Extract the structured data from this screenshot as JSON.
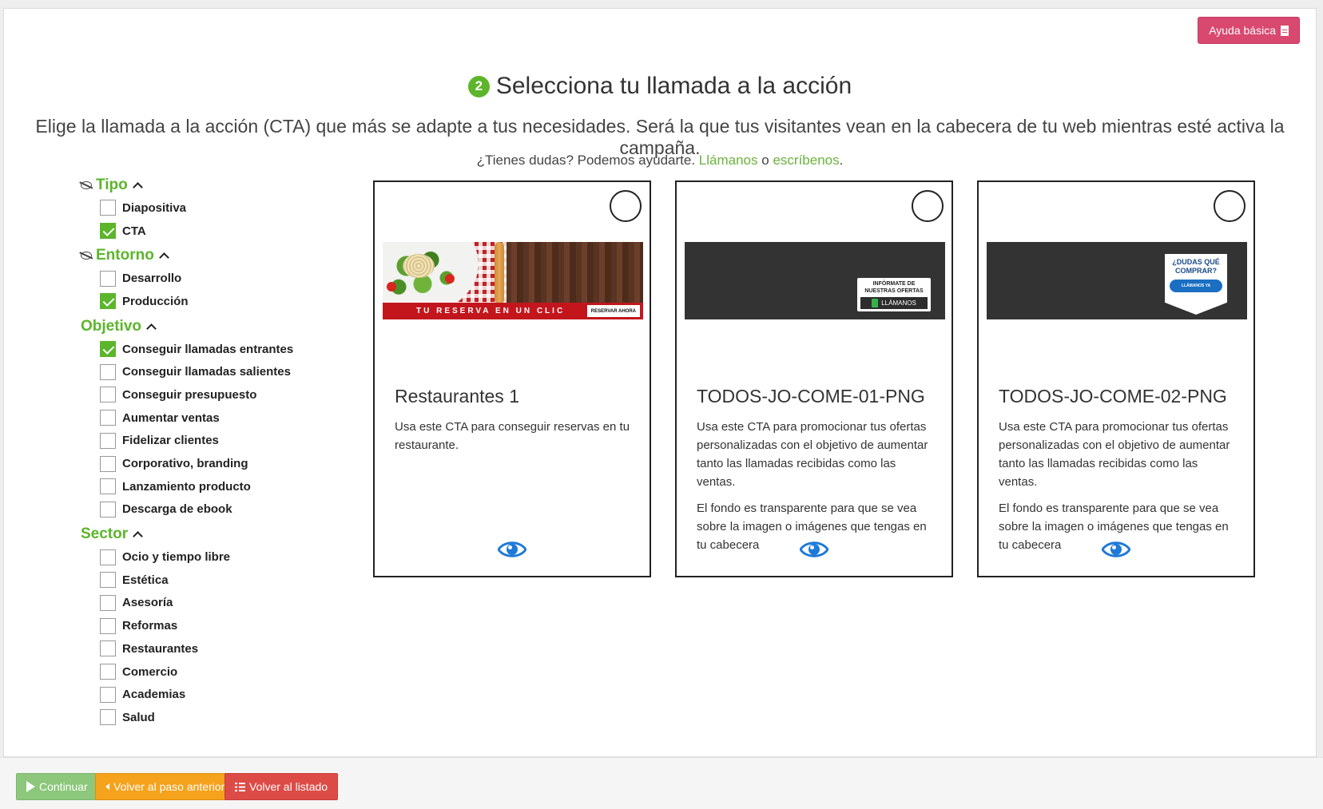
{
  "help_button": {
    "label": "Ayuda básica"
  },
  "header": {
    "step_number": "2",
    "title": "Selecciona tu llamada a la acción",
    "subtitle": "Elige la llamada a la acción (CTA) que más se adapte a tus necesidades. Será la que tus visitantes vean en la cabecera de tu web mientras esté activa la campaña.",
    "help_prefix": "¿Tienes dudas? Podemos ayudarte.",
    "help_call_link": "Llámanos",
    "help_or": "o",
    "help_write_link": "escríbenos",
    "help_suffix": "."
  },
  "filters": {
    "groups": [
      {
        "title": "Tipo",
        "has_eye_icon": true,
        "options": [
          {
            "label": "Diapositiva",
            "checked": false
          },
          {
            "label": "CTA",
            "checked": true
          }
        ]
      },
      {
        "title": "Entorno",
        "has_eye_icon": true,
        "options": [
          {
            "label": "Desarrollo",
            "checked": false
          },
          {
            "label": "Producción",
            "checked": true
          }
        ]
      },
      {
        "title": "Objetivo",
        "has_eye_icon": false,
        "options": [
          {
            "label": "Conseguir llamadas entrantes",
            "checked": true
          },
          {
            "label": "Conseguir llamadas salientes",
            "checked": false
          },
          {
            "label": "Conseguir presupuesto",
            "checked": false
          },
          {
            "label": "Aumentar ventas",
            "checked": false
          },
          {
            "label": "Fidelizar clientes",
            "checked": false
          },
          {
            "label": "Corporativo, branding",
            "checked": false
          },
          {
            "label": "Lanzamiento producto",
            "checked": false
          },
          {
            "label": "Descarga de ebook",
            "checked": false
          }
        ]
      },
      {
        "title": "Sector",
        "has_eye_icon": false,
        "options": [
          {
            "label": "Ocio y tiempo libre",
            "checked": false
          },
          {
            "label": "Estética",
            "checked": false
          },
          {
            "label": "Asesoría",
            "checked": false
          },
          {
            "label": "Reformas",
            "checked": false
          },
          {
            "label": "Restaurantes",
            "checked": false
          },
          {
            "label": "Comercio",
            "checked": false
          },
          {
            "label": "Academias",
            "checked": false
          },
          {
            "label": "Salud",
            "checked": false
          }
        ]
      }
    ]
  },
  "cards": [
    {
      "title": "Restaurantes 1",
      "banner": "restaurant",
      "banner_text": "TU RESERVA EN UN CLIC",
      "banner_button": "RESERVAR AHORA",
      "description": [
        "Usa este CTA para conseguir reservas en tu restaurante."
      ]
    },
    {
      "title": "TODOS-JO-COME-01-PNG",
      "banner": "offers",
      "banner_text": "INFÓRMATE DE NUESTRAS OFERTAS",
      "banner_button": "LLÁMANOS",
      "description": [
        "Usa este CTA para promocionar tus ofertas personalizadas con el objetivo de aumentar tanto las llamadas recibidas como las ventas.",
        "El fondo es transparente para que se vea sobre la imagen o imágenes que tengas en tu cabecera"
      ]
    },
    {
      "title": "TODOS-JO-COME-02-PNG",
      "banner": "doubts",
      "banner_text": "¿DUDAS QUÉ COMPRAR?",
      "banner_button": "LLÁMANOS YA",
      "description": [
        "Usa este CTA para promocionar tus ofertas personalizadas con el objetivo de aumentar tanto las llamadas recibidas como las ventas.",
        "El fondo es transparente para que se vea sobre la imagen o imágenes que tengas en tu cabecera"
      ]
    }
  ],
  "footer": {
    "continue_label": "Continuar",
    "back_label": "Volver al paso anterior",
    "list_label": "Volver al listado"
  },
  "colors": {
    "accent_green": "#5cb52a",
    "help_pink": "#d9486f",
    "eye_blue": "#1e7ad8",
    "continue_green": "#8cc77b",
    "back_orange": "#f5a21c",
    "list_red": "#dd4b46"
  }
}
